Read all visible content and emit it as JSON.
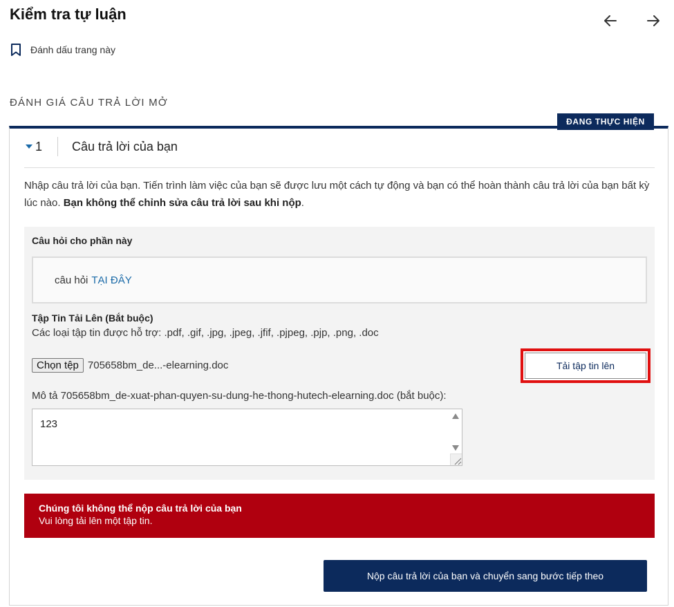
{
  "header": {
    "title": "Kiểm tra tự luận",
    "bookmark_label": "Đánh dấu trang này"
  },
  "section": {
    "heading": "ĐÁNH GIÁ CÂU TRẢ LỜI MỞ",
    "status_badge": "ĐANG THỰC HIỆN"
  },
  "step": {
    "number": "1",
    "title": "Câu trả lời của bạn",
    "instructions_normal": "Nhập câu trả lời của bạn. Tiến trình làm việc của bạn sẽ được lưu một cách tự động và bạn có thể hoàn thành câu trả lời của bạn bất kỳ lúc nào. ",
    "instructions_bold": "Bạn không thể chỉnh sửa câu trả lời sau khi nộp",
    "instructions_end": "."
  },
  "question": {
    "label": "Câu hỏi cho phần này",
    "text": "câu hỏi",
    "link_text": "TẠI ĐÂY"
  },
  "upload": {
    "label": "Tập Tin Tải Lên (Bắt buộc)",
    "supported_types": "Các loại tập tin được hỗ trợ: .pdf, .gif, .jpg, .jpeg, .jfif, .pjpeg, .pjp, .png, .doc",
    "choose_button": "Chọn tệp",
    "file_name": "705658bm_de...-elearning.doc",
    "upload_button": "Tải tập tin lên",
    "description_label": "Mô tả 705658bm_de-xuat-phan-quyen-su-dung-he-thong-hutech-elearning.doc (bắt buộc):",
    "description_value": "123"
  },
  "error": {
    "title": "Chúng tôi không thể nộp câu trả lời của bạn",
    "message": "Vui lòng tải lên một tập tin."
  },
  "submit_button": "Nộp câu trả lời của bạn và chuyển sang bước tiếp theo",
  "colors": {
    "primary": "#0c2a5c",
    "error": "#b0000f",
    "highlight": "#e01010",
    "link": "#1a6aa8"
  },
  "icons": {
    "prev": "arrow-left-icon",
    "next": "arrow-right-icon",
    "bookmark": "bookmark-icon",
    "collapse": "chevron-down-icon"
  }
}
